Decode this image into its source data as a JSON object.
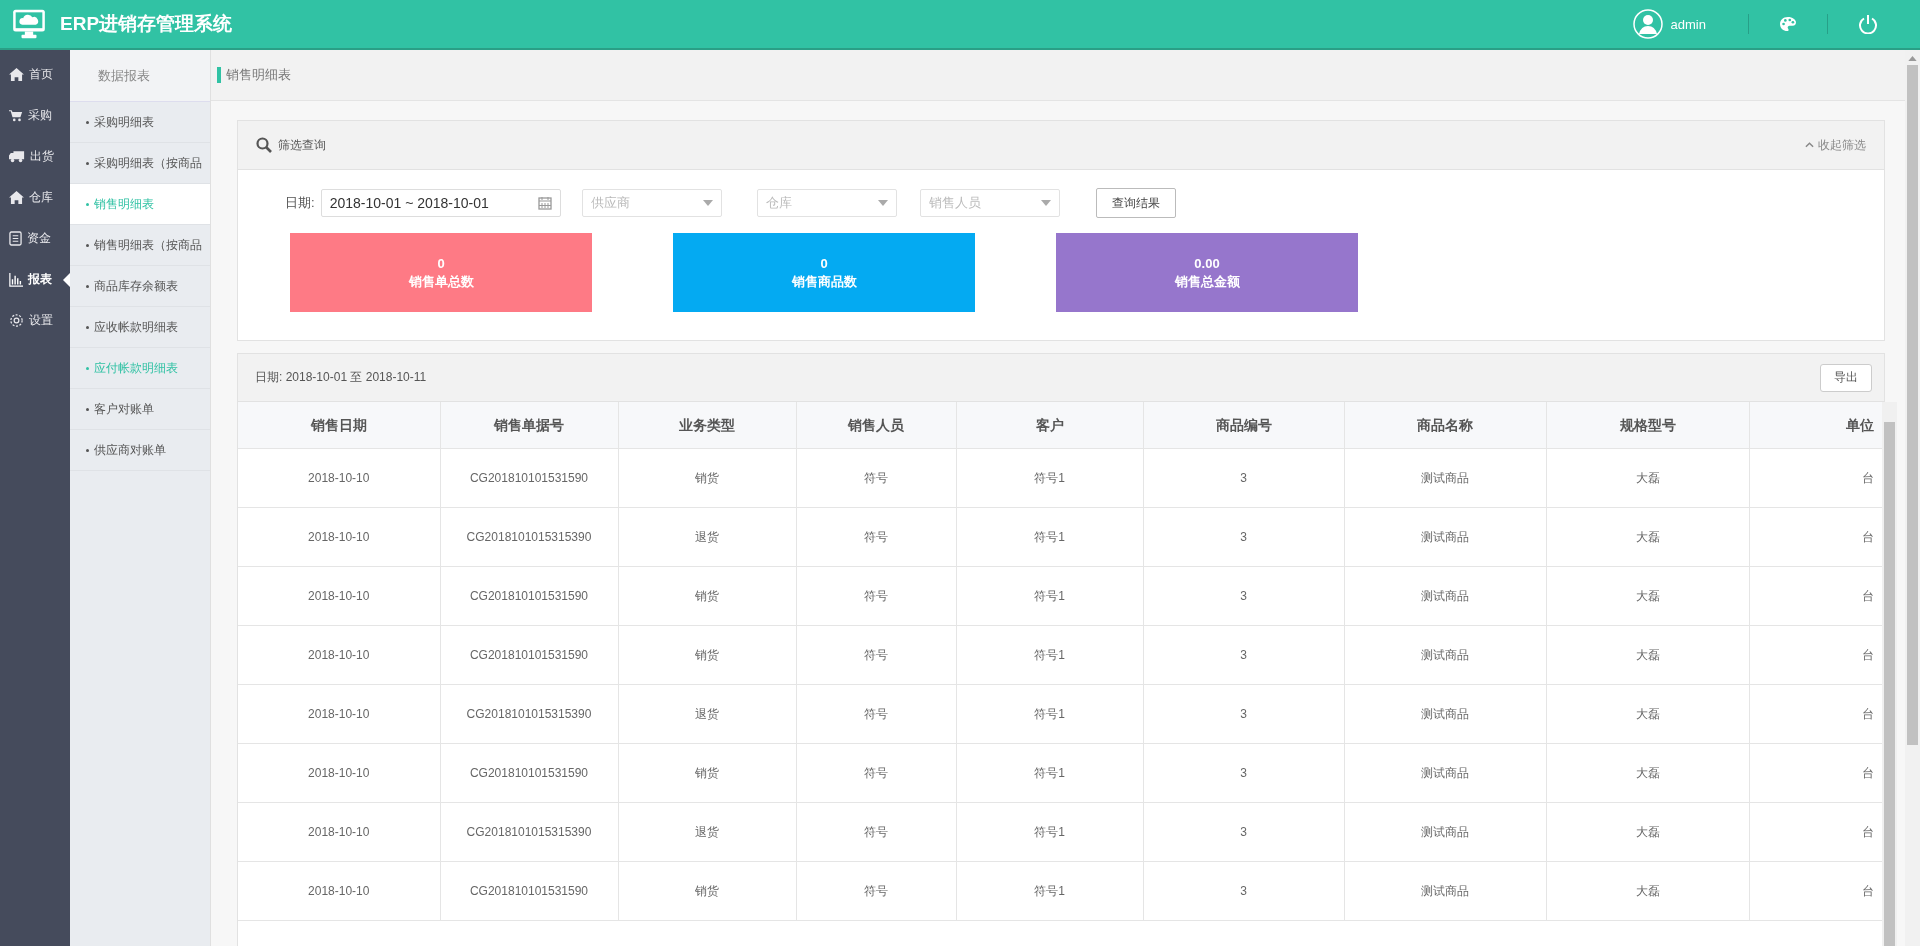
{
  "header": {
    "title": "ERP进销存管理系统",
    "user": "admin"
  },
  "nav": [
    {
      "label": "首页",
      "selected": false
    },
    {
      "label": "采购",
      "selected": false
    },
    {
      "label": "出货",
      "selected": false
    },
    {
      "label": "仓库",
      "selected": false
    },
    {
      "label": "资金",
      "selected": false
    },
    {
      "label": "报表",
      "selected": true
    },
    {
      "label": "设置",
      "selected": false
    }
  ],
  "submenu": {
    "title": "数据报表",
    "items": [
      {
        "label": "采购明细表",
        "selected": false,
        "hovered": false
      },
      {
        "label": "采购明细表（按商品",
        "selected": false,
        "hovered": false
      },
      {
        "label": "销售明细表",
        "selected": true,
        "hovered": false
      },
      {
        "label": "销售明细表（按商品",
        "selected": false,
        "hovered": false
      },
      {
        "label": "商品库存余额表",
        "selected": false,
        "hovered": false
      },
      {
        "label": "应收帐款明细表",
        "selected": false,
        "hovered": false
      },
      {
        "label": "应付帐款明细表",
        "selected": false,
        "hovered": true
      },
      {
        "label": "客户对账单",
        "selected": false,
        "hovered": false
      },
      {
        "label": "供应商对账单",
        "selected": false,
        "hovered": false
      }
    ]
  },
  "breadcrumb": "销售明细表",
  "filter": {
    "title": "筛选查询",
    "collapse": "收起筛选",
    "date_label": "日期:",
    "date_value": "2018-10-01 ~ 2018-10-01",
    "selects": [
      {
        "placeholder": "供应商"
      },
      {
        "placeholder": "仓库"
      },
      {
        "placeholder": "销售人员"
      }
    ],
    "button": "查询结果"
  },
  "stats": [
    {
      "value": "0",
      "label": "销售单总数",
      "color": "#fe7a85"
    },
    {
      "value": "0",
      "label": "销售商品数",
      "color": "#04aaf2"
    },
    {
      "value": "0.00",
      "label": "销售总金额",
      "color": "#9676cc"
    }
  ],
  "table": {
    "range": "日期: 2018-10-01 至 2018-10-11",
    "export": "导出",
    "columns": [
      "销售日期",
      "销售单据号",
      "业务类型",
      "销售人员",
      "客户",
      "商品编号",
      "商品名称",
      "规格型号",
      "单位"
    ],
    "rows": [
      [
        "2018-10-10",
        "CG201810101531590",
        "销货",
        "符号",
        "符号1",
        "3",
        "测试商品",
        "大磊",
        "台"
      ],
      [
        "2018-10-10",
        "CG2018101015315390",
        "退货",
        "符号",
        "符号1",
        "3",
        "测试商品",
        "大磊",
        "台"
      ],
      [
        "2018-10-10",
        "CG201810101531590",
        "销货",
        "符号",
        "符号1",
        "3",
        "测试商品",
        "大磊",
        "台"
      ],
      [
        "2018-10-10",
        "CG201810101531590",
        "销货",
        "符号",
        "符号1",
        "3",
        "测试商品",
        "大磊",
        "台"
      ],
      [
        "2018-10-10",
        "CG2018101015315390",
        "退货",
        "符号",
        "符号1",
        "3",
        "测试商品",
        "大磊",
        "台"
      ],
      [
        "2018-10-10",
        "CG201810101531590",
        "销货",
        "符号",
        "符号1",
        "3",
        "测试商品",
        "大磊",
        "台"
      ],
      [
        "2018-10-10",
        "CG2018101015315390",
        "退货",
        "符号",
        "符号1",
        "3",
        "测试商品",
        "大磊",
        "台"
      ],
      [
        "2018-10-10",
        "CG201810101531590",
        "销货",
        "符号",
        "符号1",
        "3",
        "测试商品",
        "大磊",
        "台"
      ]
    ]
  }
}
